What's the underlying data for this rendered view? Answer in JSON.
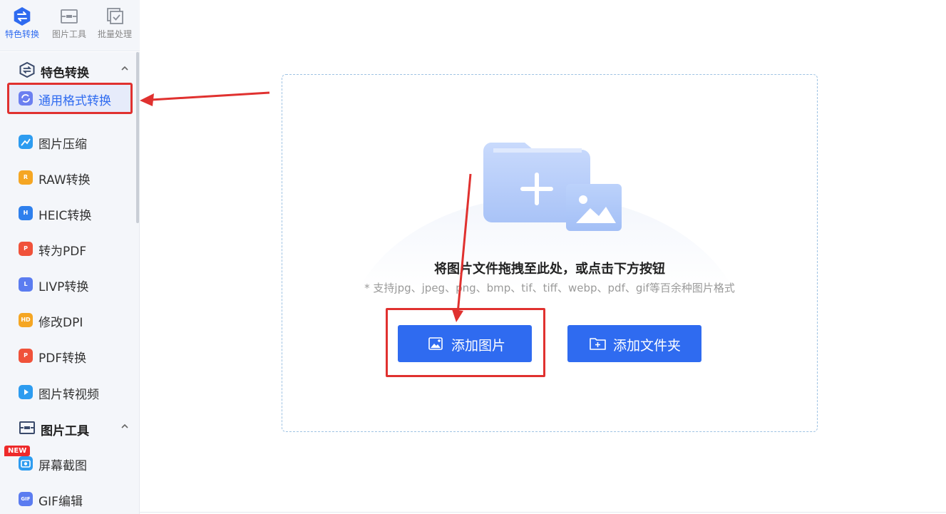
{
  "top_tabs": [
    {
      "label": "特色转换",
      "icon": "convert-icon",
      "active": true
    },
    {
      "label": "图片工具",
      "icon": "image-tool-icon",
      "active": false
    },
    {
      "label": "批量处理",
      "icon": "batch-icon",
      "active": false
    }
  ],
  "sidebar": {
    "groups": [
      {
        "title": "特色转换",
        "icon": "convert-icon",
        "expanded": true,
        "items": [
          {
            "label": "通用格式转换",
            "icon": "refresh-icon",
            "color": "#6b7ff0",
            "active": true
          },
          {
            "label": "图片压缩",
            "icon": "compress-icon",
            "color": "#2d9cf0"
          },
          {
            "label": "RAW转换",
            "icon": "raw-icon",
            "color": "#f5a623"
          },
          {
            "label": "HEIC转换",
            "icon": "heic-icon",
            "color": "#2f80ed"
          },
          {
            "label": "转为PDF",
            "icon": "pdf-icon",
            "color": "#f0523a"
          },
          {
            "label": "LIVP转换",
            "icon": "livp-icon",
            "color": "#5b7cf0"
          },
          {
            "label": "修改DPI",
            "icon": "dpi-icon",
            "color": "#f5a623"
          },
          {
            "label": "PDF转换",
            "icon": "pdf-convert-icon",
            "color": "#f0523a"
          },
          {
            "label": "图片转视频",
            "icon": "video-icon",
            "color": "#2d9cf0"
          }
        ]
      },
      {
        "title": "图片工具",
        "icon": "image-tool-icon",
        "expanded": true,
        "items": [
          {
            "label": "屏幕截图",
            "icon": "screenshot-icon",
            "color": "#2d9cf0",
            "badge": "NEW"
          },
          {
            "label": "GIF编辑",
            "icon": "gif-icon",
            "color": "#5b7cf0"
          }
        ]
      }
    ]
  },
  "dropzone": {
    "title": "将图片文件拖拽至此处，或点击下方按钮",
    "subtitle": "* 支持jpg、jpeg、png、bmp、tif、tiff、webp、pdf、gif等百余种图片格式",
    "add_image_label": "添加图片",
    "add_folder_label": "添加文件夹"
  },
  "colors": {
    "accent": "#2f6bf0",
    "highlight": "#e0312f",
    "sidebar_bg": "#f4f6fa"
  }
}
